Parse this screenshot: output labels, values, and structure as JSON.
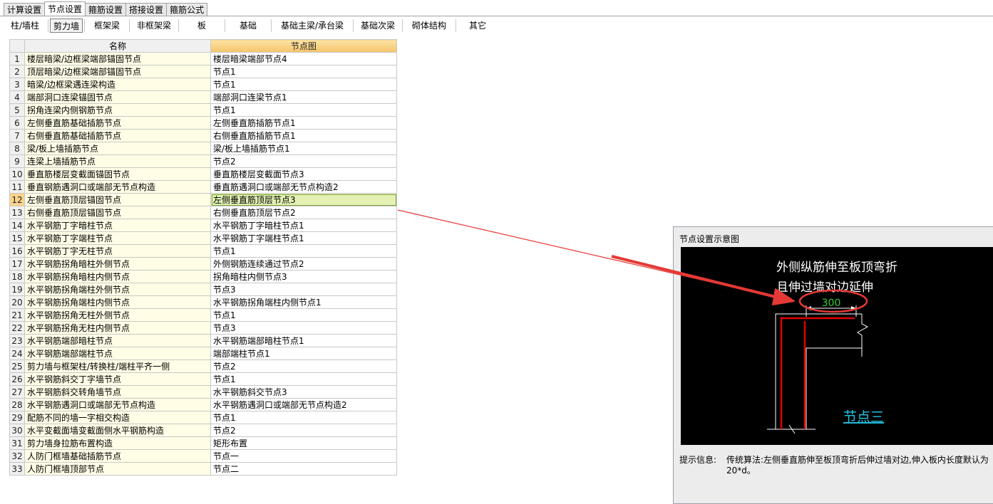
{
  "tabs": [
    "计算设置",
    "节点设置",
    "箍筋设置",
    "搭接设置",
    "箍筋公式"
  ],
  "active_tab": 1,
  "subtabs": [
    "柱/墙柱",
    "剪力墙",
    "框架梁",
    "非框架梁",
    "板",
    "基础",
    "基础主梁/承台梁",
    "基础次梁",
    "砌体结构",
    "其它"
  ],
  "active_subtab": 1,
  "grid": {
    "col_name": "名称",
    "col_node": "节点图",
    "selected_row": 12,
    "rows": [
      {
        "no": "1",
        "name": "楼层暗梁/边框梁端部锚固节点",
        "node": "楼层暗梁端部节点4"
      },
      {
        "no": "2",
        "name": "顶层暗梁/边框梁端部锚固节点",
        "node": "节点1"
      },
      {
        "no": "3",
        "name": "暗梁/边框梁遇连梁构造",
        "node": "节点1"
      },
      {
        "no": "4",
        "name": "端部洞口连梁锚固节点",
        "node": "端部洞口连梁节点1"
      },
      {
        "no": "5",
        "name": "拐角连梁内侧钢筋节点",
        "node": "节点1"
      },
      {
        "no": "6",
        "name": "左侧垂直筋基础插筋节点",
        "node": "左侧垂直筋插筋节点1"
      },
      {
        "no": "7",
        "name": "右侧垂直筋基础插筋节点",
        "node": "右侧垂直筋插筋节点1"
      },
      {
        "no": "8",
        "name": "梁/板上墙插筋节点",
        "node": "梁/板上墙插筋节点1"
      },
      {
        "no": "9",
        "name": "连梁上墙插筋节点",
        "node": "节点2"
      },
      {
        "no": "10",
        "name": "垂直筋楼层变截面锚固节点",
        "node": "垂直筋楼层变截面节点3"
      },
      {
        "no": "11",
        "name": "垂直钢筋遇洞口或端部无节点构造",
        "node": "垂直筋遇洞口或端部无节点构造2"
      },
      {
        "no": "12",
        "name": "左侧垂直筋顶层锚固节点",
        "node": "左侧垂直筋顶层节点3"
      },
      {
        "no": "13",
        "name": "右侧垂直筋顶层锚固节点",
        "node": "右侧垂直筋顶层节点2"
      },
      {
        "no": "14",
        "name": "水平钢筋丁字暗柱节点",
        "node": "水平钢筋丁字暗柱节点1"
      },
      {
        "no": "15",
        "name": "水平钢筋丁字端柱节点",
        "node": "水平钢筋丁字端柱节点1"
      },
      {
        "no": "16",
        "name": "水平钢筋丁字无柱节点",
        "node": "节点1"
      },
      {
        "no": "17",
        "name": "水平钢筋拐角暗柱外侧节点",
        "node": "外侧钢筋连续通过节点2"
      },
      {
        "no": "18",
        "name": "水平钢筋拐角暗柱内侧节点",
        "node": "拐角暗柱内侧节点3"
      },
      {
        "no": "19",
        "name": "水平钢筋拐角端柱外侧节点",
        "node": "节点3"
      },
      {
        "no": "20",
        "name": "水平钢筋拐角端柱内侧节点",
        "node": "水平钢筋拐角端柱内侧节点1"
      },
      {
        "no": "21",
        "name": "水平钢筋拐角无柱外侧节点",
        "node": "节点1"
      },
      {
        "no": "22",
        "name": "水平钢筋拐角无柱内侧节点",
        "node": "节点3"
      },
      {
        "no": "23",
        "name": "水平钢筋端部暗柱节点",
        "node": "水平钢筋端部暗柱节点1"
      },
      {
        "no": "24",
        "name": "水平钢筋端部端柱节点",
        "node": "端部端柱节点1"
      },
      {
        "no": "25",
        "name": "剪力墙与框架柱/转换柱/端柱平齐一侧",
        "node": "节点2"
      },
      {
        "no": "26",
        "name": "水平钢筋斜交丁字墙节点",
        "node": "节点1"
      },
      {
        "no": "27",
        "name": "水平钢筋斜交转角墙节点",
        "node": "水平钢筋斜交节点3"
      },
      {
        "no": "28",
        "name": "水平钢筋遇洞口或端部无节点构造",
        "node": "水平钢筋遇洞口或端部无节点构造2"
      },
      {
        "no": "29",
        "name": "配筋不同的墙一字相交构造",
        "node": "节点1"
      },
      {
        "no": "30",
        "name": "水平变截面墙变截面侧水平钢筋构造",
        "node": "节点2"
      },
      {
        "no": "31",
        "name": "剪力墙身拉筋布置构造",
        "node": "矩形布置"
      },
      {
        "no": "32",
        "name": "人防门框墙基础插筋节点",
        "node": "节点一"
      },
      {
        "no": "33",
        "name": "人防门框墙顶部节点",
        "node": "节点二"
      }
    ]
  },
  "dialog": {
    "title": "节点设置示意图",
    "diagram_line1": "外侧纵筋伸至板顶弯折",
    "diagram_line2": "且伸过墙对边延伸",
    "dimension": "300",
    "node_caption": "节点三",
    "hint_label": "提示信息:",
    "hint_text": "传统算法:左侧垂直筋伸至板顶弯折后伸过墙对边,伸入板内长度默认为20*d。"
  },
  "colors": {
    "annotation_red": "#e53935",
    "diagram_rebar": "#e00000",
    "diagram_line": "#ffffff",
    "diagram_dim": "#30d030",
    "diagram_caption": "#22c5e6",
    "selected_row": "#e3f2b4"
  }
}
